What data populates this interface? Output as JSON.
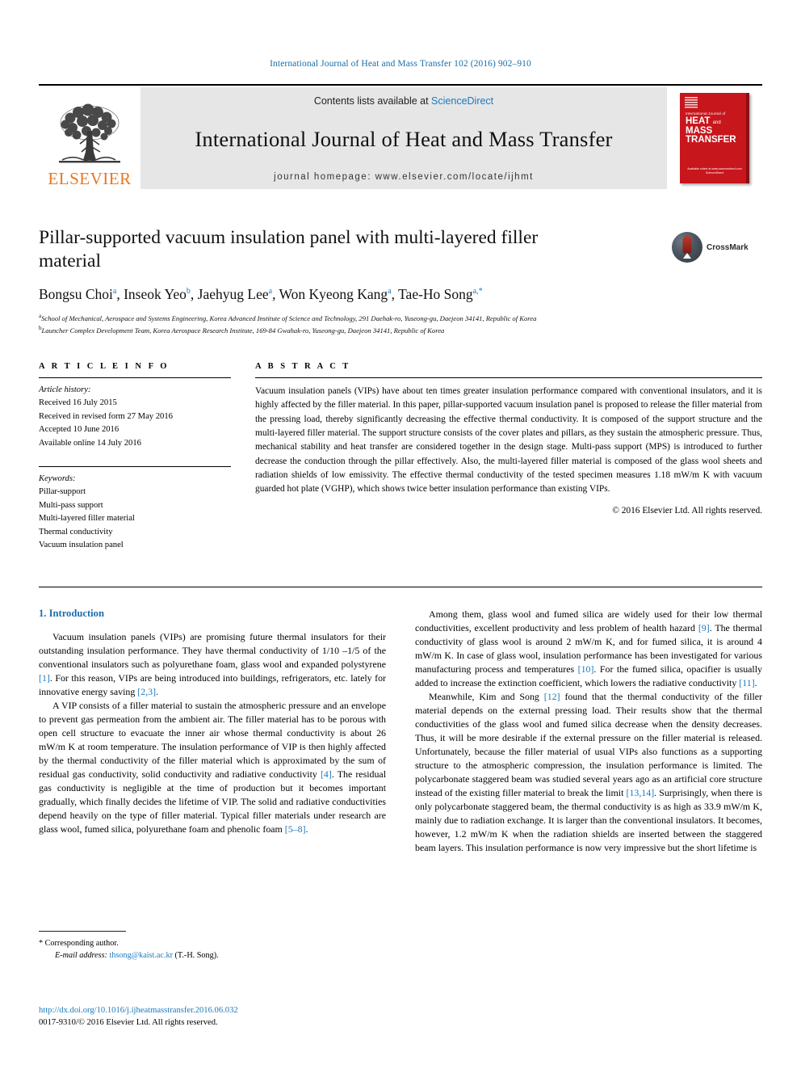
{
  "running_head": "International Journal of Heat and Mass Transfer 102 (2016) 902–910",
  "masthead": {
    "contents_prefix": "Contents lists available at ",
    "sciencedirect": "ScienceDirect",
    "journal_name": "International Journal of Heat and Mass Transfer",
    "homepage": "journal homepage: www.elsevier.com/locate/ijhmt",
    "publisher": "ELSEVIER",
    "publisher_color": "#E87722",
    "cover": {
      "small_title": "International Journal of",
      "big_title_line1": "HEAT",
      "big_title_and": "and",
      "big_title_line1b": "MASS",
      "big_title_line2": "TRANSFER",
      "footer_line1": "Available online at www.sciencedirect.com",
      "footer_line2": "ScienceDirect",
      "color": "#c8161d"
    }
  },
  "article": {
    "title": "Pillar-supported vacuum insulation panel with multi-layered filler material",
    "crossmark_label": "CrossMark",
    "authors": [
      {
        "name": "Bongsu Choi",
        "sup": "a"
      },
      {
        "name": "Inseok Yeo",
        "sup": "b"
      },
      {
        "name": "Jaehyug Lee",
        "sup": "a"
      },
      {
        "name": "Won Kyeong Kang",
        "sup": "a"
      },
      {
        "name": "Tae-Ho Song",
        "sup": "a,*"
      }
    ],
    "affiliations": [
      {
        "sup": "a",
        "text": "School of Mechanical, Aerospace and Systems Engineering, Korea Advanced Institute of Science and Technology, 291 Daehak-ro, Yuseong-gu, Daejeon 34141, Republic of Korea"
      },
      {
        "sup": "b",
        "text": "Launcher Complex Development Team, Korea Aerospace Research Institute, 169-84 Gwahak-ro, Yuseong-gu, Daejeon 34141, Republic of Korea"
      }
    ]
  },
  "article_info": {
    "heading": "A R T I C L E    I N F O",
    "history_label": "Article history:",
    "history": [
      "Received 16 July 2015",
      "Received in revised form 27 May 2016",
      "Accepted 10 June 2016",
      "Available online 14 July 2016"
    ],
    "keywords_label": "Keywords:",
    "keywords": [
      "Pillar-support",
      "Multi-pass support",
      "Multi-layered filler material",
      "Thermal conductivity",
      "Vacuum insulation panel"
    ]
  },
  "abstract": {
    "heading": "A B S T R A C T",
    "text": "Vacuum insulation panels (VIPs) have about ten times greater insulation performance compared with conventional insulators, and it is highly affected by the filler material. In this paper, pillar-supported vacuum insulation panel is proposed to release the filler material from the pressing load, thereby significantly decreasing the effective thermal conductivity. It is composed of the support structure and the multi-layered filler material. The support structure consists of the cover plates and pillars, as they sustain the atmospheric pressure. Thus, mechanical stability and heat transfer are considered together in the design stage. Multi-pass support (MPS) is introduced to further decrease the conduction through the pillar effectively. Also, the multi-layered filler material is composed of the glass wool sheets and radiation shields of low emissivity. The effective thermal conductivity of the tested specimen measures 1.18 mW/m K with vacuum guarded hot plate (VGHP), which shows twice better insulation performance than existing VIPs.",
    "copyright": "© 2016 Elsevier Ltd. All rights reserved."
  },
  "body": {
    "section_heading": "1. Introduction",
    "left_paragraphs": [
      "Vacuum insulation panels (VIPs) are promising future thermal insulators for their outstanding insulation performance. They have thermal conductivity of 1/10 –1/5 of the conventional insulators such as polyurethane foam, glass wool and expanded polystyrene [1]. For this reason, VIPs are being introduced into buildings, refrigerators, etc. lately for innovative energy saving [2,3].",
      "A VIP consists of a filler material to sustain the atmospheric pressure and an envelope to prevent gas permeation from the ambient air. The filler material has to be porous with open cell structure to evacuate the inner air whose thermal conductivity is about 26 mW/m K at room temperature. The insulation performance of VIP is then highly affected by the thermal conductivity of the filler material which is approximated by the sum of residual gas conductivity, solid conductivity and radiative conductivity [4]. The residual gas conductivity is negligible at the time of production but it becomes important gradually, which finally decides the lifetime of VIP. The solid and radiative conductivities depend heavily on the type of filler material. Typical filler materials under research are glass wool, fumed silica, polyurethane foam and phenolic foam [5–8]."
    ],
    "right_paragraphs": [
      "Among them, glass wool and fumed silica are widely used for their low thermal conductivities, excellent productivity and less problem of health hazard [9]. The thermal conductivity of glass wool is around 2 mW/m K, and for fumed silica, it is around 4 mW/m K. In case of glass wool, insulation performance has been investigated for various manufacturing process and temperatures [10]. For the fumed silica, opacifier is usually added to increase the extinction coefficient, which lowers the radiative conductivity [11].",
      "Meanwhile, Kim and Song [12] found that the thermal conductivity of the filler material depends on the external pressing load. Their results show that the thermal conductivities of the glass wool and fumed silica decrease when the density decreases. Thus, it will be more desirable if the external pressure on the filler material is released. Unfortunately, because the filler material of usual VIPs also functions as a supporting structure to the atmospheric compression, the insulation performance is limited. The polycarbonate staggered beam was studied several years ago as an artificial core structure instead of the existing filler material to break the limit [13,14]. Surprisingly, when there is only polycarbonate staggered beam, the thermal conductivity is as high as 33.9 mW/m K, mainly due to radiation exchange. It is larger than the conventional insulators. It becomes, however, 1.2 mW/m K when the radiation shields are inserted between the staggered beam layers. This insulation performance is now very impressive but the short lifetime is"
    ]
  },
  "footnote": {
    "corresponding_marker": "*",
    "corresponding_text": "Corresponding author.",
    "email_label": "E-mail address:",
    "email": "thsong@kaist.ac.kr",
    "email_owner": "(T.-H. Song)."
  },
  "doi": {
    "url": "http://dx.doi.org/10.1016/j.ijheatmasstransfer.2016.06.032",
    "issn_line": "0017-9310/© 2016 Elsevier Ltd. All rights reserved."
  }
}
